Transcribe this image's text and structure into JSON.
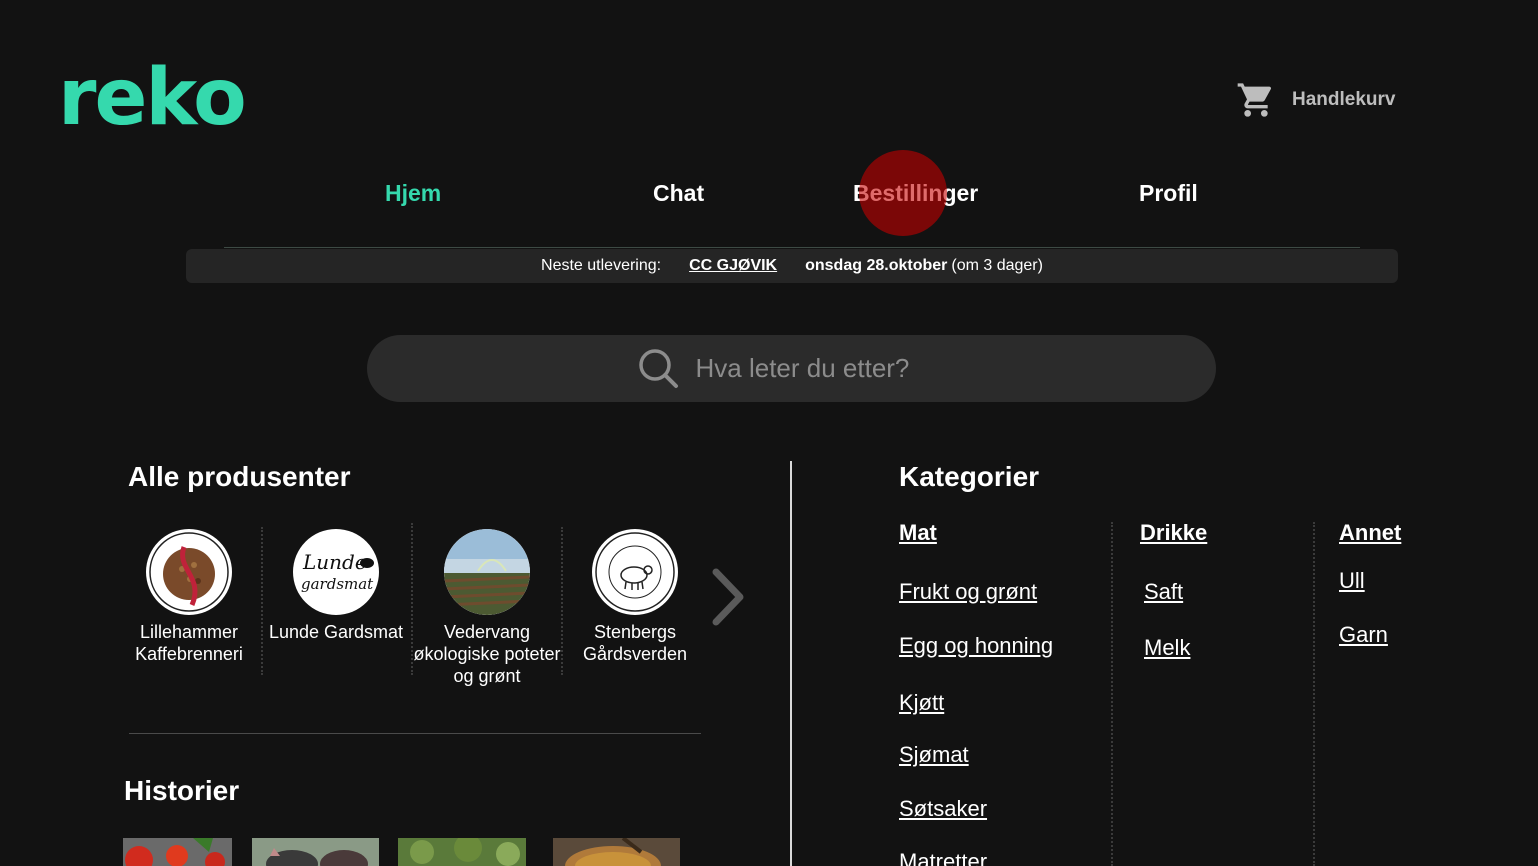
{
  "header": {
    "logo_text": "reko",
    "cart_label": "Handlekurv",
    "cart_icon": "shopping-cart-icon",
    "accent_color": "#35d9ad"
  },
  "nav": {
    "items": [
      {
        "label": "Hjem",
        "active": true
      },
      {
        "label": "Chat",
        "active": false
      },
      {
        "label": "Bestillinger",
        "active": false
      },
      {
        "label": "Profil",
        "active": false
      }
    ]
  },
  "delivery": {
    "label": "Neste utlevering:",
    "location": "CC GJØVIK",
    "date": "onsdag 28.oktober",
    "relative": "(om 3 dager)"
  },
  "search": {
    "placeholder": "Hva leter du etter?",
    "icon": "search-icon"
  },
  "producers": {
    "title": "Alle produsenter",
    "next_icon": "chevron-right-icon",
    "items": [
      {
        "name": "Lillehammer Kaffebrenneri"
      },
      {
        "name": "Lunde Gardsmat"
      },
      {
        "name": "Vedervang økologiske poteter og grønt"
      },
      {
        "name": "Stenbergs Gårdsverden"
      }
    ]
  },
  "stories": {
    "title": "Historier"
  },
  "categories": {
    "title": "Kategorier",
    "groups": [
      {
        "heading": "Mat",
        "links": [
          "Frukt og grønt",
          "Egg og honning",
          "Kjøtt",
          "Sjømat",
          "Søtsaker",
          "Matretter"
        ]
      },
      {
        "heading": "Drikke",
        "links": [
          "Saft",
          "Melk"
        ]
      },
      {
        "heading": "Annet",
        "links": [
          "Ull",
          "Garn"
        ]
      }
    ]
  }
}
